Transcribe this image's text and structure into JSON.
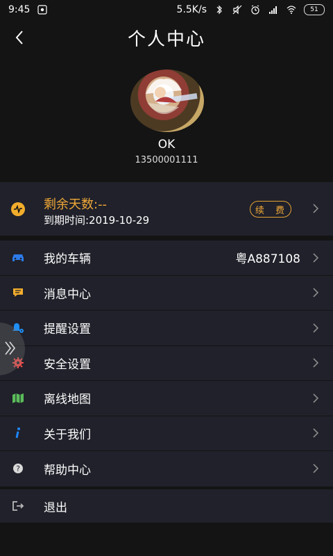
{
  "status_bar": {
    "time": "9:45",
    "network_speed": "5.5K/s",
    "battery": "51"
  },
  "title": "个人中心",
  "profile": {
    "nickname": "OK",
    "phone": "13500001111"
  },
  "membership": {
    "remaining_days": "剩余天数:--",
    "expiry": "到期时间:2019-10-29",
    "renew_label": "续 费"
  },
  "menu": {
    "vehicle_label": "我的车辆",
    "vehicle_plate": "粤A887108",
    "message_label": "消息中心",
    "reminder_label": "提醒设置",
    "security_label": "安全设置",
    "offline_map_label": "离线地图",
    "about_label": "关于我们",
    "help_label": "帮助中心"
  },
  "logout_label": "退出",
  "colors": {
    "accent_orange": "#f0a837",
    "vehicle_blue": "#2d7bea",
    "message_orange": "#f2ad2c",
    "reminder_blue": "#1f8ff5",
    "security_red": "#f04d4a",
    "map_green": "#5bbd5b",
    "about_blue": "#1e86ff",
    "help_gray": "#d9d9d9",
    "logout_gray": "#b9b9b9"
  }
}
